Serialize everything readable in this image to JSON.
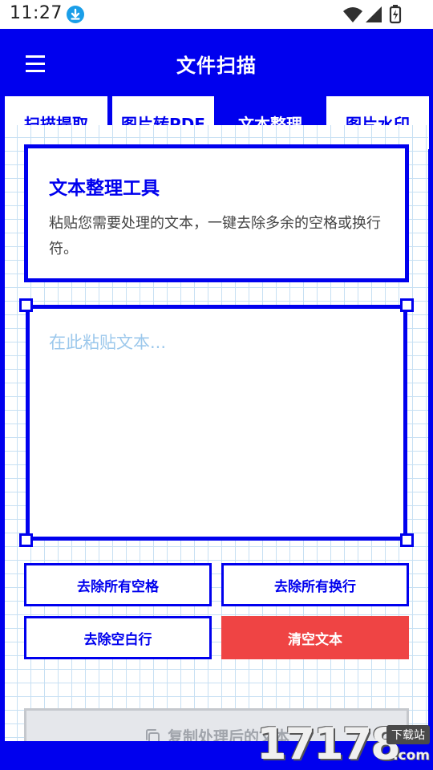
{
  "status_bar": {
    "time": "11:27",
    "icons": [
      "download-icon",
      "wifi-icon",
      "signal-icon",
      "battery-icon"
    ]
  },
  "header": {
    "title": "文件扫描",
    "menu_icon": "hamburger-menu-icon"
  },
  "tabs": [
    {
      "label": "扫描提取",
      "active": false
    },
    {
      "label": "图片转PDF",
      "active": false
    },
    {
      "label": "文本整理",
      "active": true
    },
    {
      "label": "图片水印",
      "active": false
    }
  ],
  "info_card": {
    "title": "文本整理工具",
    "description": "粘贴您需要处理的文本，一键去除多余的空格或换行符。"
  },
  "editor": {
    "value": "",
    "placeholder": "在此粘贴文本..."
  },
  "actions": {
    "remove_spaces": "去除所有空格",
    "remove_newlines": "去除所有换行",
    "remove_blank_lines": "去除空白行",
    "clear_text": "清空文本",
    "copy_result": "复制处理后的文本"
  },
  "watermark": {
    "number": "17178",
    "tag": "下载站",
    "domain": ".com"
  },
  "colors": {
    "primary": "#0000ee",
    "danger": "#ef4444",
    "grid": "#c7e0f3",
    "disabled_bg": "#e5e7eb",
    "placeholder": "#9cc8ec"
  }
}
